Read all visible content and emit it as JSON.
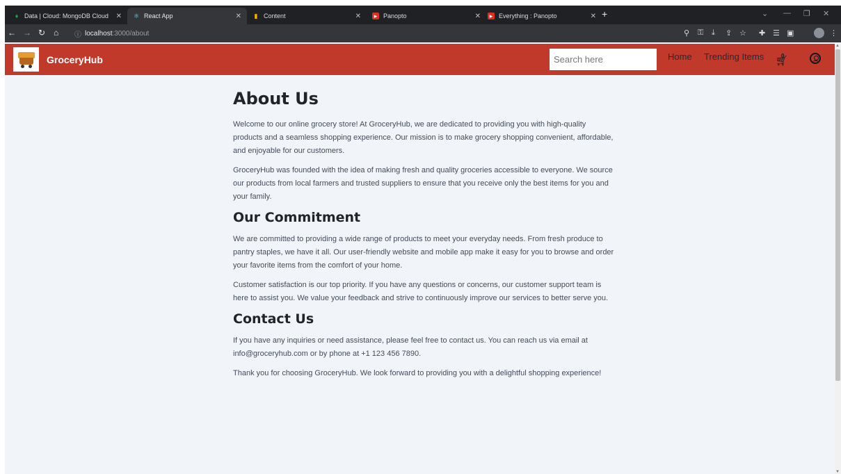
{
  "browser": {
    "tabs": [
      {
        "label": "Data | Cloud: MongoDB Cloud",
        "icon": "mongodb-leaf-icon"
      },
      {
        "label": "React App",
        "icon": "react-icon"
      },
      {
        "label": "Content",
        "icon": "bar-chart-icon"
      },
      {
        "label": "Panopto",
        "icon": "panopto-icon"
      },
      {
        "label": "Everything : Panopto",
        "icon": "panopto-icon"
      }
    ],
    "url_host": "localhost",
    "url_path": ":3000/about"
  },
  "navbar": {
    "brand": "GroceryHub",
    "search_placeholder": "Search here",
    "links": [
      "Home",
      "Trending Items"
    ],
    "cart_count": "0",
    "accent": "#c0392b"
  },
  "about": {
    "title": "About Us",
    "p1": "Welcome to our online grocery store! At GroceryHub, we are dedicated to providing you with high-quality products and a seamless shopping experience. Our mission is to make grocery shopping convenient, affordable, and enjoyable for our customers.",
    "p2": "GroceryHub was founded with the idea of making fresh and quality groceries accessible to everyone. We source our products from local farmers and trusted suppliers to ensure that you receive only the best items for you and your family."
  },
  "commitment": {
    "title": "Our Commitment",
    "p1": "We are committed to providing a wide range of products to meet your everyday needs. From fresh produce to pantry staples, we have it all. Our user-friendly website and mobile app make it easy for you to browse and order your favorite items from the comfort of your home.",
    "p2": "Customer satisfaction is our top priority. If you have any questions or concerns, our customer support team is here to assist you. We value your feedback and strive to continuously improve our services to better serve you."
  },
  "contact": {
    "title": "Contact Us",
    "p1": "If you have any inquiries or need assistance, please feel free to contact us. You can reach us via email at info@groceryhub.com or by phone at +1 123 456 7890.",
    "p2": "Thank you for choosing GroceryHub. We look forward to providing you with a delightful shopping experience!"
  }
}
